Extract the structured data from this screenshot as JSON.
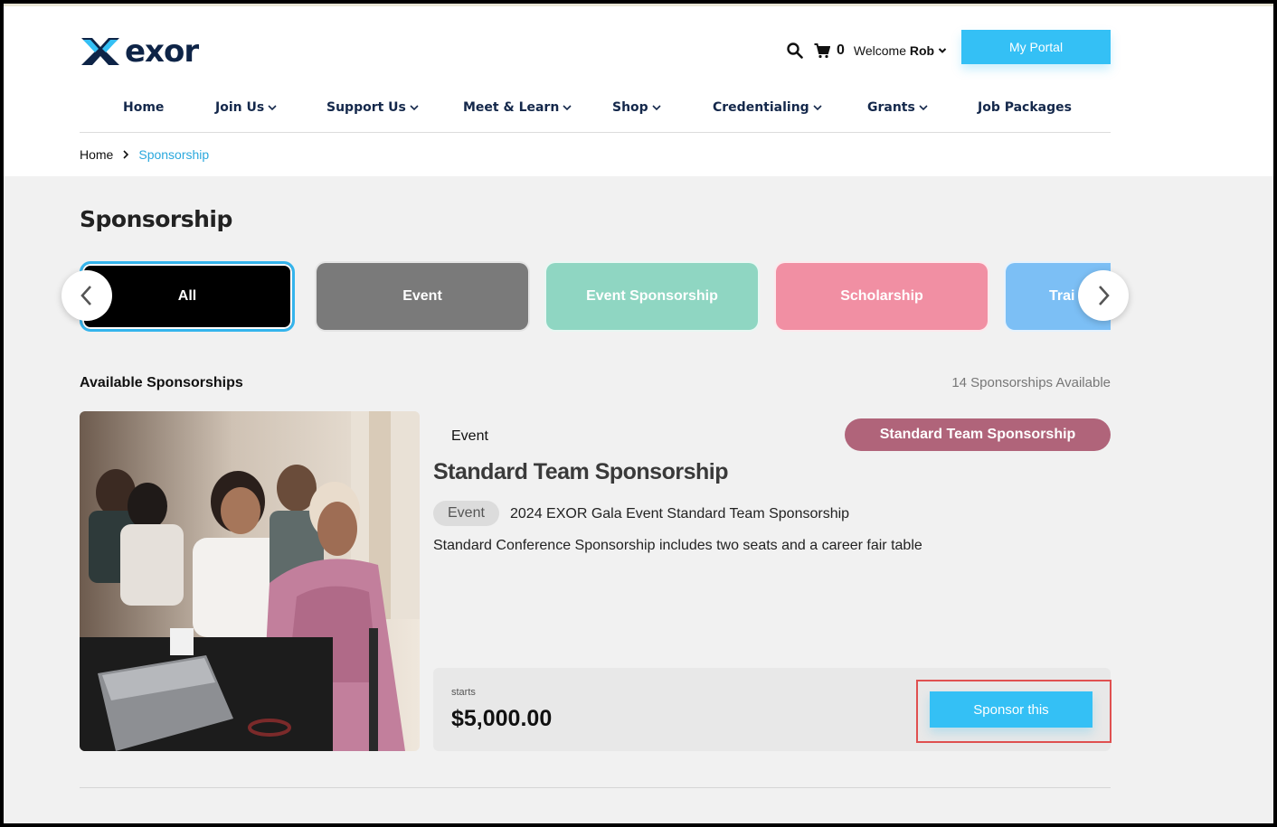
{
  "brand": {
    "name": "exor",
    "accent": "#34c0f5",
    "navy": "#0e2447"
  },
  "header": {
    "cart_count": "0",
    "welcome_prefix": "Welcome",
    "welcome_user": "Rob",
    "portal_label": "My Portal"
  },
  "nav": {
    "items": [
      {
        "label": "Home"
      },
      {
        "label": "Join Us"
      },
      {
        "label": "Support Us"
      },
      {
        "label": "Meet & Learn"
      },
      {
        "label": "Shop"
      },
      {
        "label": "Credentialing"
      },
      {
        "label": "Grants"
      },
      {
        "label": "Job Packages"
      }
    ]
  },
  "breadcrumb": {
    "home": "Home",
    "current": "Sponsorship"
  },
  "page": {
    "title": "Sponsorship"
  },
  "categories": [
    {
      "label": "All",
      "color": "#000000",
      "selected": true
    },
    {
      "label": "Event",
      "color": "#7a7a7a"
    },
    {
      "label": "Event Sponsorship",
      "color": "#8fd6c2"
    },
    {
      "label": "Scholarship",
      "color": "#f18fa3"
    },
    {
      "label": "Trai",
      "color": "#7cbff5"
    }
  ],
  "list": {
    "title": "Available Sponsorships",
    "count_text": "14 Sponsorships Available"
  },
  "card": {
    "type": "Event",
    "pill": "Standard Team Sponsorship",
    "pill_color": "#b0647a",
    "title": "Standard Team Sponsorship",
    "tag": "Event",
    "subtitle": "2024 EXOR Gala Event Standard Team Sponsorship",
    "description": "Standard Conference Sponsorship includes two seats and a career fair table",
    "price_label": "starts",
    "price": "$5,000.00",
    "cta": "Sponsor this"
  }
}
